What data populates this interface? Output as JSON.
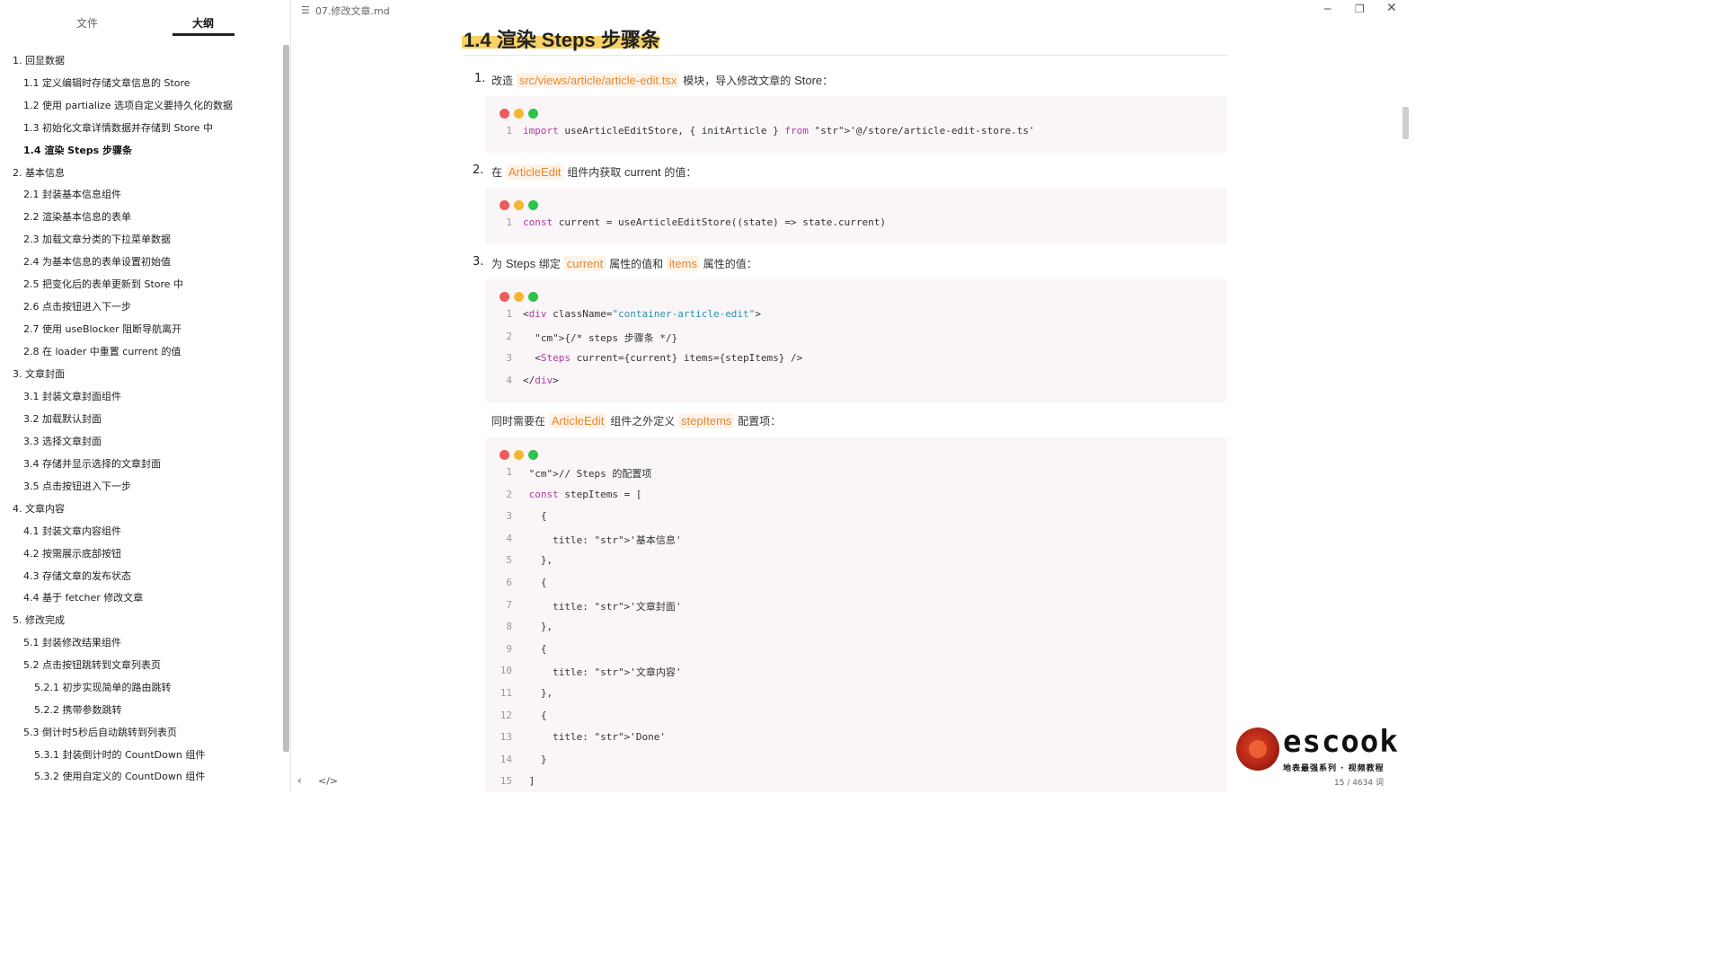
{
  "sidebar": {
    "tabs": {
      "files": "文件",
      "outline": "大纲"
    },
    "outline": [
      "1. 回显数据",
      "1.1 定义编辑时存储文章信息的 Store",
      "1.2 使用 partialize 选项自定义要持久化的数据",
      "1.3 初始化文章详情数据并存储到 Store 中",
      "1.4 渲染 Steps 步骤条",
      "2. 基本信息",
      "2.1 封装基本信息组件",
      "2.2 渲染基本信息的表单",
      "2.3 加载文章分类的下拉菜单数据",
      "2.4 为基本信息的表单设置初始值",
      "2.5 把变化后的表单更新到 Store 中",
      "2.6 点击按钮进入下一步",
      "2.7 使用 useBlocker 阻断导航离开",
      "2.8 在 loader 中重置 current 的值",
      "3. 文章封面",
      "3.1 封装文章封面组件",
      "3.2 加载默认封面",
      "3.3 选择文章封面",
      "3.4 存储并显示选择的文章封面",
      "3.5 点击按钮进入下一步",
      "4. 文章内容",
      "4.1 封装文章内容组件",
      "4.2 按需展示底部按钮",
      "4.3 存储文章的发布状态",
      "4.4 基于 fetcher 修改文章",
      "5. 修改完成",
      "5.1 封装修改结果组件",
      "5.2 点击按钮跳转到文章列表页",
      "5.2.1 初步实现简单的路由跳转",
      "5.2.2 携带参数跳转",
      "5.3 倒计时5秒后自动跳转到列表页",
      "5.3.1 封装倒计时的 CountDown 组件",
      "5.3.2 使用自定义的 CountDown 组件"
    ]
  },
  "titlebar": {
    "doc_icon": "☰",
    "doc_title": "07.修改文章.md",
    "min": "─",
    "max": "❐",
    "close": "✕"
  },
  "content": {
    "heading": "1.4 渲染 Steps 步骤条",
    "step1": {
      "num": "1.",
      "pre": "改造",
      "code": "src/views/article/article-edit.tsx",
      "post": "模块，导入修改文章的",
      "en": "Store",
      "end": "："
    },
    "step2": {
      "num": "2.",
      "pre": "在",
      "code": "ArticleEdit",
      "mid": "组件内获取",
      "en": "current",
      "end": "的值："
    },
    "step3": {
      "num": "3.",
      "pre": "为",
      "en": "Steps",
      "mid": "绑定",
      "code1": "current",
      "mid2": "属性的值和",
      "code2": "items",
      "end": "属性的值："
    },
    "note": {
      "pre": "同时需要在",
      "code1": "ArticleEdit",
      "mid": "组件之外定义",
      "code2": "stepItems",
      "end": "配置项："
    },
    "block1": [
      {
        "n": "1",
        "t": "import useArticleEditStore, { initArticle } from '@/store/article-edit-store.ts'"
      }
    ],
    "block2": [
      {
        "n": "1",
        "t": "const current = useArticleEditStore((state) => state.current)"
      }
    ],
    "block3": [
      {
        "n": "1",
        "t": "<div className=\"container-article-edit\">"
      },
      {
        "n": "2",
        "t": "  {/* steps 步骤条 */}"
      },
      {
        "n": "3",
        "t": "  <Steps current={current} items={stepItems} />"
      },
      {
        "n": "4",
        "t": "</div>"
      }
    ],
    "block4": [
      {
        "n": "1",
        "t": " // Steps 的配置项"
      },
      {
        "n": "2",
        "t": " const stepItems = ["
      },
      {
        "n": "3",
        "t": "   {"
      },
      {
        "n": "4",
        "t": "     title: '基本信息'"
      },
      {
        "n": "5",
        "t": "   },"
      },
      {
        "n": "6",
        "t": "   {"
      },
      {
        "n": "7",
        "t": "     title: '文章封面'"
      },
      {
        "n": "8",
        "t": "   },"
      },
      {
        "n": "9",
        "t": "   {"
      },
      {
        "n": "10",
        "t": "     title: '文章内容'"
      },
      {
        "n": "11",
        "t": "   },"
      },
      {
        "n": "12",
        "t": "   {"
      },
      {
        "n": "13",
        "t": "     title: 'Done'"
      },
      {
        "n": "14",
        "t": "   }"
      },
      {
        "n": "15",
        "t": " ]"
      }
    ]
  },
  "bottombar": {
    "back": "‹",
    "source": "</>",
    "word_count": "15 / 4634 词"
  },
  "watermark": {
    "name": "escook",
    "sub": "地表最强系列 · 视频教程"
  }
}
